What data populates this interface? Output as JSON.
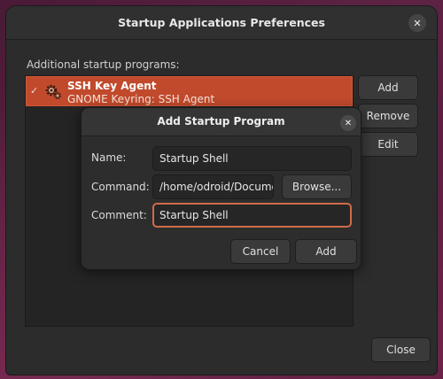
{
  "window": {
    "title": "Startup Applications Preferences",
    "close_glyph": "✕",
    "section_label": "Additional startup programs:",
    "close_button_label": "Close"
  },
  "startup_list": [
    {
      "checked": true,
      "check_glyph": "✓",
      "name": "SSH Key Agent",
      "description": "GNOME Keyring: SSH Agent",
      "icon": "gear-icon"
    }
  ],
  "side_buttons": {
    "add": "Add",
    "remove": "Remove",
    "edit": "Edit"
  },
  "dialog": {
    "title": "Add Startup Program",
    "close_glyph": "✕",
    "name_label": "Name:",
    "name_value": "Startup Shell",
    "command_label": "Command:",
    "command_value": "/home/odroid/Documents/",
    "browse_label": "Browse...",
    "comment_label": "Comment:",
    "comment_value": "Startup Shell",
    "cancel_label": "Cancel",
    "add_label": "Add"
  },
  "colors": {
    "selection": "#c14a2c",
    "focus_ring": "#d06b4a",
    "window_bg": "#2c2c2c"
  }
}
